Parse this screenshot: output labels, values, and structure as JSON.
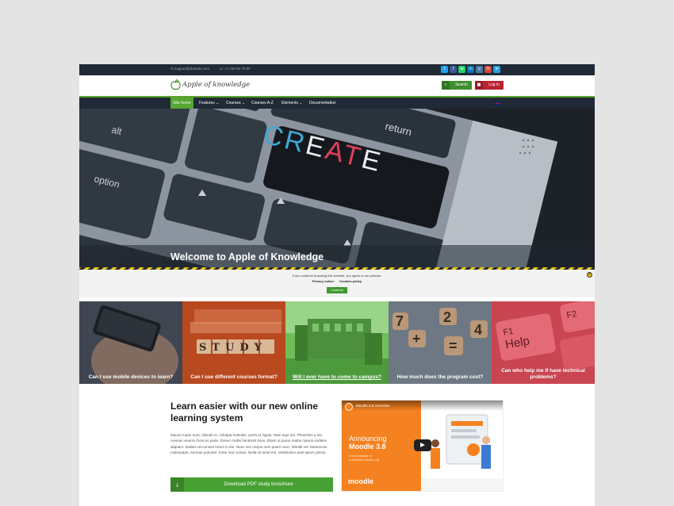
{
  "topbar": {
    "email": "support@domain.com",
    "phone": "+1 234 56 78 90",
    "social_icons": [
      "twitter-icon",
      "facebook-icon",
      "whatsapp-icon",
      "linkedin-icon",
      "vk-icon",
      "email-icon",
      "telegram-icon"
    ]
  },
  "header": {
    "logo_text": "Apple of knowledge",
    "search_label": "Search",
    "login_label": "Log in"
  },
  "nav": {
    "items": [
      {
        "label": "Site home",
        "active": true
      },
      {
        "label": "Features ⌄"
      },
      {
        "label": "Courses ⌄"
      },
      {
        "label": "Courses A-Z"
      },
      {
        "label": "Elements ⌄"
      },
      {
        "label": "Documentation"
      }
    ]
  },
  "hero": {
    "title": "Welcome to Apple of Knowledge",
    "keys": {
      "alt": "alt",
      "option": "option",
      "create": "CREATE",
      "return": "return"
    }
  },
  "cookie": {
    "message": "If you continue browsing this website, you agree to our policies:",
    "privacy": "Privacy notice",
    "cookies": "Cookies policy",
    "continue": "Continue"
  },
  "tiles": [
    {
      "label": "Can I use mobile devices to learn?",
      "color": "#5a6370"
    },
    {
      "label": "Can I use different courses format?",
      "color": "#c0532a"
    },
    {
      "label": "Will I ever have to come to campus?",
      "color": "#5aa84a"
    },
    {
      "label": "How much does the program cost?",
      "color": "#5b6672"
    },
    {
      "label": "Can who help me if have technical problems?",
      "color": "#d4505d"
    }
  ],
  "tile_text": {
    "study": "STUDY",
    "f1": "F1",
    "help": "Help",
    "f2": "F2",
    "nums": [
      "7",
      "2",
      "4",
      "+",
      "="
    ]
  },
  "learn": {
    "title": "Learn easier with our new online learning system",
    "body": "Mauris turpis nunc, blandit et, volutpat molestie, porta ut, ligula. Nam eget dui. Phasellus a est. Aenean viverra rhoncus pede. Donec mollis hendrerit risus. Etiam ut purus mattis mauris sodales aliquam. Nullam accumsan lorem in dui. Nunc nec neque nam quam nunc, blandit vel. Maecenas malesuada. Aenean posuere, tortor sed cursus. Nulla sit amet est. Vestibulum ante ipsum primis.",
    "download_label": "Download PDF study broschure"
  },
  "video": {
    "title": "Moodle 3.8 Overview",
    "announcing": "Announcing",
    "version": "Moodle 3.8",
    "sub1": "Now available to",
    "sub2": "download.moodle.org",
    "brand": "moodle"
  },
  "colors": {
    "accent": "#55a530",
    "danger": "#b8232f",
    "dark": "#1f2a36"
  }
}
